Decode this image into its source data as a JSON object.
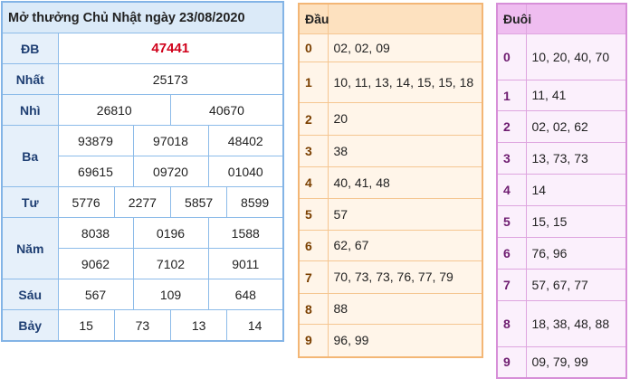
{
  "title": "Mở thưởng Chủ Nhật ngày 23/08/2020",
  "labels": {
    "db": "ĐB",
    "nhat": "Nhất",
    "nhi": "Nhì",
    "ba": "Ba",
    "tu": "Tư",
    "nam": "Năm",
    "sau": "Sáu",
    "bay": "Bảy"
  },
  "results": {
    "db": "47441",
    "nhat": "25173",
    "nhi": [
      "26810",
      "40670"
    ],
    "ba": [
      "93879",
      "97018",
      "48402",
      "69615",
      "09720",
      "01040"
    ],
    "tu": [
      "5776",
      "2277",
      "5857",
      "8599"
    ],
    "nam": [
      "8038",
      "0196",
      "1588",
      "9062",
      "7102",
      "9011"
    ],
    "sau": [
      "567",
      "109",
      "648"
    ],
    "bay": [
      "15",
      "73",
      "13",
      "14"
    ]
  },
  "dau": {
    "header": "Đầu",
    "rows": [
      {
        "d": "0",
        "v": "02, 02, 09"
      },
      {
        "d": "1",
        "v": "10, 11, 13, 14, 15, 15, 18"
      },
      {
        "d": "2",
        "v": "20"
      },
      {
        "d": "3",
        "v": "38"
      },
      {
        "d": "4",
        "v": "40, 41, 48"
      },
      {
        "d": "5",
        "v": "57"
      },
      {
        "d": "6",
        "v": "62, 67"
      },
      {
        "d": "7",
        "v": "70, 73, 73, 76, 77, 79"
      },
      {
        "d": "8",
        "v": "88"
      },
      {
        "d": "9",
        "v": "96, 99"
      }
    ]
  },
  "duoi": {
    "header": "Đuôi",
    "rows": [
      {
        "d": "0",
        "v": "10, 20, 40, 70"
      },
      {
        "d": "1",
        "v": "11, 41"
      },
      {
        "d": "2",
        "v": "02, 02, 62"
      },
      {
        "d": "3",
        "v": "13, 73, 73"
      },
      {
        "d": "4",
        "v": "14"
      },
      {
        "d": "5",
        "v": "15, 15"
      },
      {
        "d": "6",
        "v": "76, 96"
      },
      {
        "d": "7",
        "v": "57, 67, 77"
      },
      {
        "d": "8",
        "v": "18, 38, 48, 88"
      },
      {
        "d": "9",
        "v": "09, 79, 99"
      }
    ]
  },
  "colors": {
    "special_prize": "#d0021b",
    "result_border": "#83b4e6",
    "dau_header": "#fde1bf",
    "duoi_header": "#efbdf0"
  }
}
